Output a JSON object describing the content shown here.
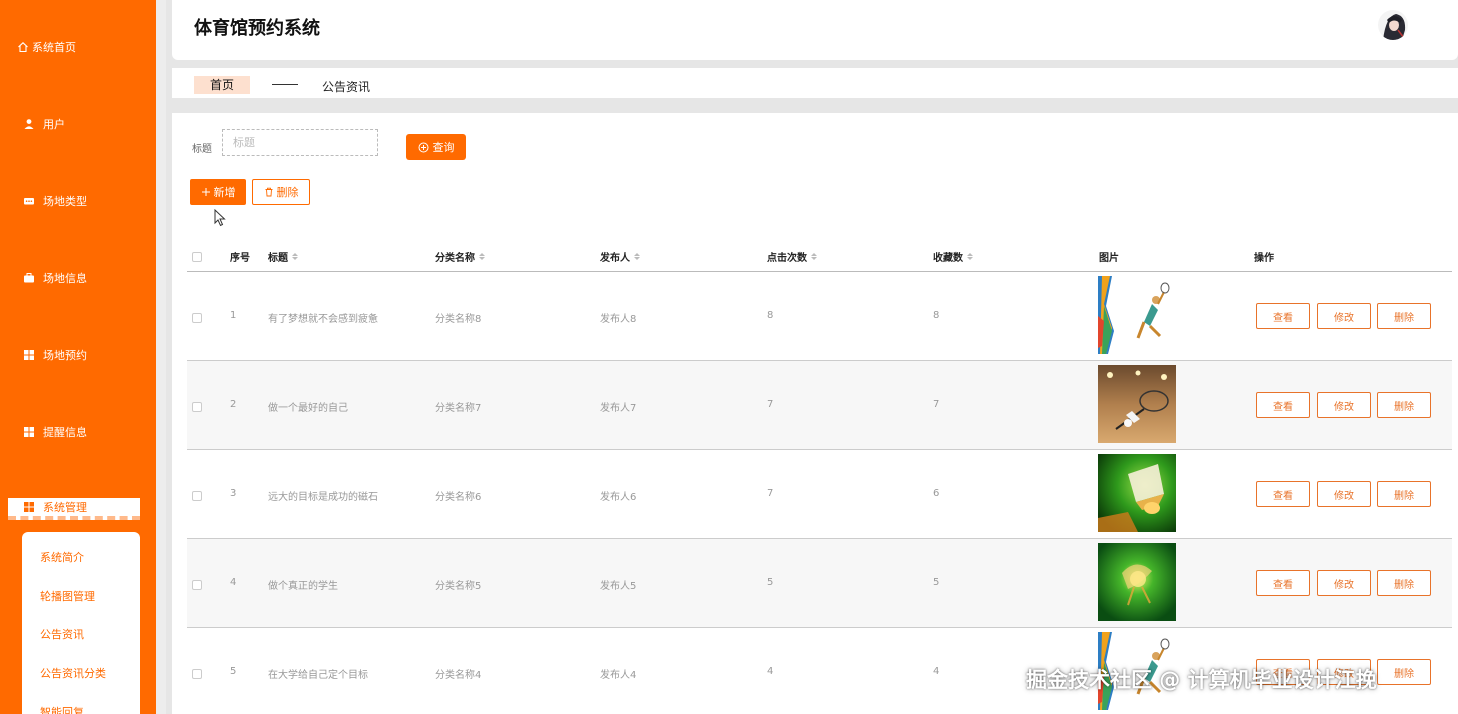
{
  "sidebar": {
    "items": [
      {
        "label": "系统首页",
        "icon": "home-icon"
      },
      {
        "label": "用户",
        "icon": "user-icon"
      },
      {
        "label": "场地类型",
        "icon": "chat-dots-icon"
      },
      {
        "label": "场地信息",
        "icon": "briefcase-icon"
      },
      {
        "label": "场地预约",
        "icon": "grid-icon"
      },
      {
        "label": "提醒信息",
        "icon": "grid-icon"
      },
      {
        "label": "系统管理",
        "icon": "grid-icon"
      }
    ],
    "submenu": [
      "系统简介",
      "轮播图管理",
      "公告资讯",
      "公告资讯分类",
      "智能回复"
    ]
  },
  "header": {
    "title": "体育馆预约系统"
  },
  "breadcrumb": {
    "home": "首页",
    "current": "公告资讯"
  },
  "search": {
    "label": "标题",
    "placeholder": "标题",
    "query_button": "查询"
  },
  "toolbar": {
    "add_button": "新增",
    "delete_button": "删除"
  },
  "table": {
    "headers": {
      "index": "序号",
      "title": "标题",
      "category": "分类名称",
      "publisher": "发布人",
      "clicks": "点击次数",
      "favorites": "收藏数",
      "image": "图片",
      "actions": "操作"
    },
    "rows": [
      {
        "index": "1",
        "title": "有了梦想就不会感到疲惫",
        "category": "分类名称8",
        "publisher": "发布人8",
        "clicks": "8",
        "favorites": "8",
        "image": "badminton-player-illustration"
      },
      {
        "index": "2",
        "title": "做一个最好的自己",
        "category": "分类名称7",
        "publisher": "发布人7",
        "clicks": "7",
        "favorites": "7",
        "image": "shuttlecock-racket-court-photo"
      },
      {
        "index": "3",
        "title": "远大的目标是成功的磁石",
        "category": "分类名称6",
        "publisher": "发布人6",
        "clicks": "7",
        "favorites": "6",
        "image": "shuttlecock-green-glow-photo"
      },
      {
        "index": "4",
        "title": "做个真正的学生",
        "category": "分类名称5",
        "publisher": "发布人5",
        "clicks": "5",
        "favorites": "5",
        "image": "glowing-green-art"
      },
      {
        "index": "5",
        "title": "在大学给自己定个目标",
        "category": "分类名称4",
        "publisher": "发布人4",
        "clicks": "4",
        "favorites": "4",
        "image": "badminton-player-illustration"
      }
    ],
    "row_actions": {
      "view": "查看",
      "edit": "修改",
      "delete": "删除"
    }
  },
  "watermark": "掘金技术社区 @ 计算机毕业设计江挽",
  "colors": {
    "accent": "#ff6a00",
    "submenu_text": "#ff6a00",
    "breadcrumb_home_bg": "#fde0cf"
  }
}
